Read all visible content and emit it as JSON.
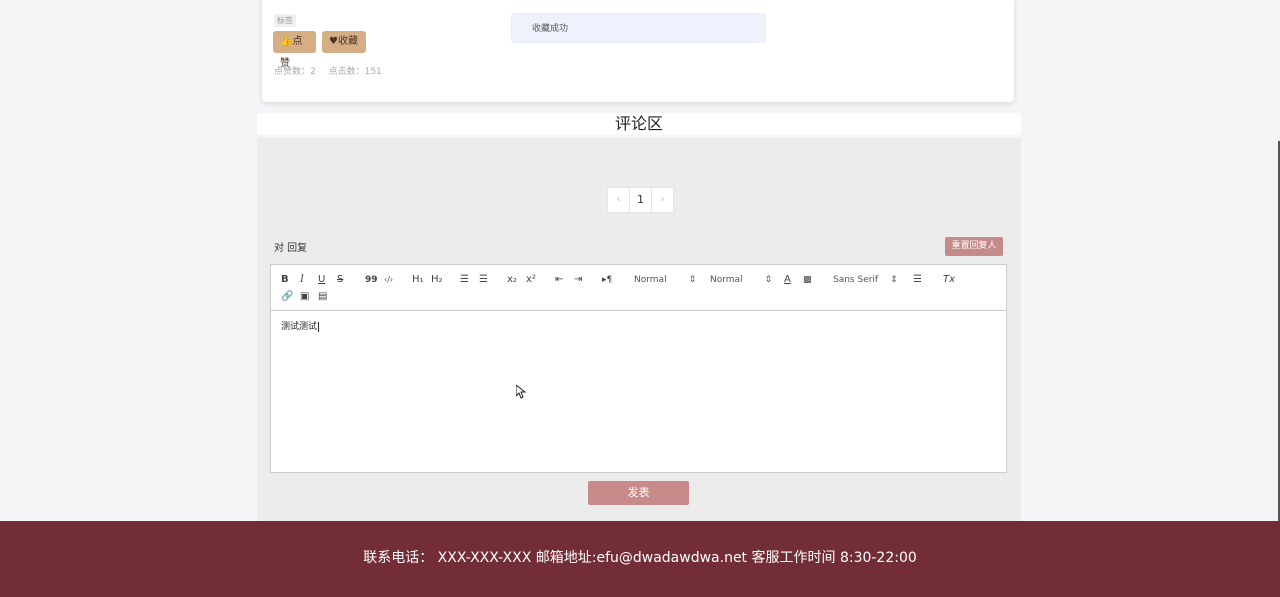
{
  "post": {
    "tag": "标签",
    "like_label": "点赞",
    "favorite_label": "收藏",
    "like_count_label": "点赞数：2",
    "click_count_label": "点击数：151"
  },
  "toast": {
    "message": "收藏成功"
  },
  "comments": {
    "title": "评论区",
    "pagination": {
      "prev": "‹",
      "current": "1",
      "next": "›"
    },
    "reply_label": "对 回复",
    "reset_button": "重置回复人",
    "editor": {
      "toolbar": {
        "bold": "B",
        "italic": "I",
        "underline": "U",
        "strike": "S",
        "blockquote": "99",
        "code": "‹/›",
        "h1": "H₁",
        "h2": "H₂",
        "sub": "x₂",
        "sup": "x²",
        "rtl": "▸¶",
        "size_select": "Normal",
        "header_select": "Normal",
        "font_select": "Sans Serif",
        "clean": "Tx"
      },
      "content": "测试测试"
    },
    "submit_label": "发表"
  },
  "footer": {
    "text": "联系电话： XXX-XXX-XXX 邮箱地址:efu@dwadawdwa.net 客服工作时间 8:30-22:00"
  },
  "colors": {
    "accent_tan": "#d5ae86",
    "rose": "#c98a8a",
    "footer_bg": "#722d37",
    "toast_bg": "#edf2fc"
  }
}
